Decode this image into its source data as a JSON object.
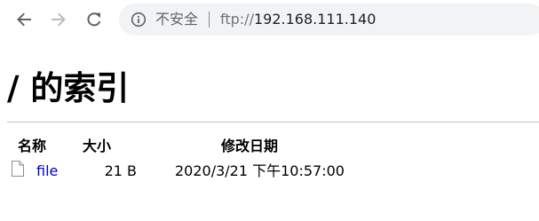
{
  "browser": {
    "security_label": "不安全",
    "url_scheme": "ftp://",
    "url_host": "192.168.111.140"
  },
  "page": {
    "title": "/ 的索引",
    "columns": {
      "name": "名称",
      "size": "大小",
      "date": "修改日期"
    },
    "rows": [
      {
        "name": "file",
        "size": "21 B",
        "date": "2020/3/21 下午10:57:00"
      }
    ]
  },
  "colors": {
    "link": "#0000cc",
    "omnibox_bg": "#f1f3f4"
  }
}
